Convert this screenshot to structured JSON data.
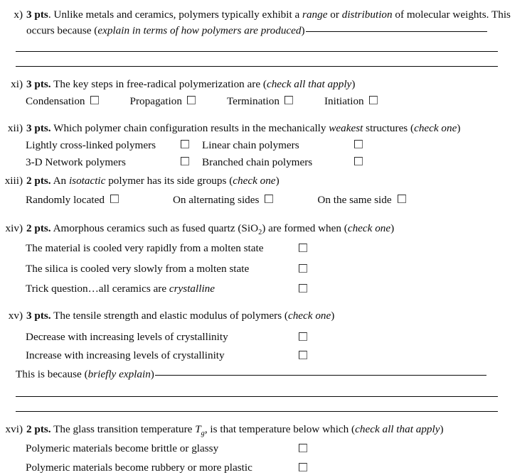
{
  "questions": [
    {
      "num": "x)",
      "pts": "3 pts",
      "pts_suffix": ".",
      "prompt_before": " Unlike metals and ceramics, polymers typically exhibit a ",
      "em1": "range",
      "mid1": " or ",
      "em2": "distribution",
      "after": " of molecular weights. This occurs because (",
      "parenthetical": "explain in terms of how polymers are produced",
      "close": ")"
    },
    {
      "num": "xi)",
      "pts": "3 pts.",
      "prompt": " The key steps in free-radical polymerization are (",
      "parenthetical": "check all that apply",
      "close": ")",
      "options": [
        "Condensation",
        "Propagation",
        "Termination",
        "Initiation"
      ]
    },
    {
      "num": "xii)",
      "pts": "3 pts.",
      "prompt_before": " Which polymer chain configuration results in the mechanically ",
      "em": "weakest",
      "prompt_after": " structures (",
      "parenthetical": "check one",
      "close": ")",
      "options_left": [
        "Lightly cross-linked polymers",
        "3-D Network polymers"
      ],
      "options_right": [
        "Linear chain polymers",
        "Branched chain polymers"
      ]
    },
    {
      "num": "xiii)",
      "pts": "2 pts.",
      "prompt_before": " An ",
      "em": "isotactic",
      "prompt_after": " polymer has its side groups (",
      "parenthetical": "check one",
      "close": ")",
      "options": [
        "Randomly located",
        "On alternating sides",
        "On the same side"
      ]
    },
    {
      "num": "xiv)",
      "pts": "2 pts.",
      "prompt_before": " Amorphous ceramics such as fused quartz (SiO",
      "subscript": "2",
      "prompt_after": ") are formed when (",
      "parenthetical": "check one",
      "close": ")",
      "options": [
        {
          "text": "The material is cooled very rapidly from a molten state",
          "em": ""
        },
        {
          "text": "The silica is cooled very slowly from a molten state",
          "em": ""
        },
        {
          "text": "Trick question…all ceramics are ",
          "em": "crystalline"
        }
      ]
    },
    {
      "num": "xv)",
      "pts": "3 pts.",
      "prompt": " The tensile strength and elastic modulus of polymers (",
      "parenthetical": "check one",
      "close": ")",
      "options": [
        "Decrease with increasing levels of crystallinity",
        "Increase with increasing levels of crystallinity"
      ],
      "followup_before": "This is because (",
      "followup_em": "briefly explain",
      "followup_close": ")"
    },
    {
      "num": "xvi)",
      "pts": "2 pts.",
      "prompt_before": " The glass transition temperature ",
      "symbol": "T",
      "symbol_sub": "g",
      "prompt_after": ", is that temperature below which (",
      "parenthetical": "check all that apply",
      "close": ")",
      "options": [
        "Polymeric materials become brittle or glassy",
        "Polymeric materials become rubbery or more plastic"
      ]
    }
  ],
  "checkbox": {
    "state": "unchecked",
    "border_color": "#2e2e2e"
  },
  "rule_color": "#0a0a0a"
}
